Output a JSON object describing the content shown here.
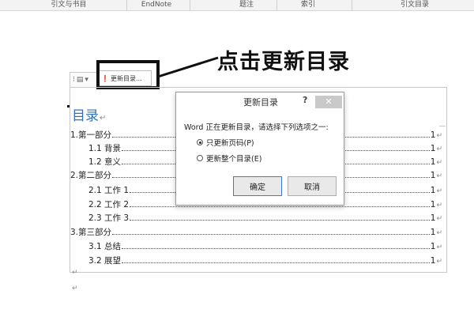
{
  "ribbon": {
    "groups": [
      "引文与书目",
      "EndNote",
      "题注",
      "索引",
      "引文目录"
    ]
  },
  "toc_control": {
    "update_button_label": "更新目录..."
  },
  "annotation": {
    "callout_text": "点击更新目录"
  },
  "document": {
    "toc_title": "目录",
    "toc_entries": [
      {
        "label": "1.第一部分",
        "page": "1"
      },
      {
        "label": "1.1 背景",
        "page": "1"
      },
      {
        "label": "1.2 意义",
        "page": "1"
      },
      {
        "label": "2.第二部分",
        "page": "1"
      },
      {
        "label": "2.1 工作 1",
        "page": "1"
      },
      {
        "label": "2.2 工作 2",
        "page": "1"
      },
      {
        "label": "2.3 工作 3",
        "page": "1"
      },
      {
        "label": "3.第三部分",
        "page": "1"
      },
      {
        "label": "3.1 总结",
        "page": "1"
      },
      {
        "label": "3.2 展望",
        "page": "1"
      }
    ]
  },
  "dialog": {
    "title": "更新目录",
    "help": "?",
    "close": "✕",
    "message": "Word 正在更新目录，请选择下列选项之一:",
    "options": [
      {
        "label": "只更新页码(P)",
        "checked": true
      },
      {
        "label": "更新整个目录(E)",
        "checked": false
      }
    ],
    "ok_label": "确定",
    "cancel_label": "取消"
  },
  "colors": {
    "title_blue": "#2f73c0",
    "ok_border": "#3a7bd5"
  }
}
